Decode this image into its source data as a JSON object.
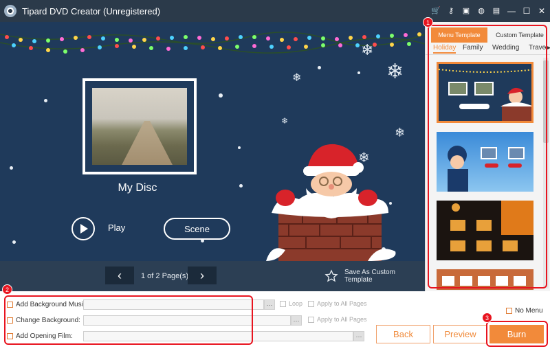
{
  "window": {
    "title": "Tipard DVD Creator (Unregistered)",
    "toolbar_icons": [
      "cart-icon",
      "key-icon",
      "save-icon",
      "help-icon",
      "feedback-icon"
    ],
    "controls": {
      "minimize": "—",
      "maximize": "☐",
      "close": "✕"
    }
  },
  "preview": {
    "disc_title": "My Disc",
    "play_label": "Play",
    "scene_label": "Scene"
  },
  "pagebar": {
    "prev": "‹",
    "next": "›",
    "page_count": "1 of 2 Page(s)",
    "save_template": "Save As Custom Template"
  },
  "right_panel": {
    "tabs": [
      "Menu Template",
      "Custom Template"
    ],
    "active_tab": "Menu Template",
    "categories": [
      "Holiday",
      "Family",
      "Wedding",
      "Trave"
    ],
    "selected_category": "Holiday",
    "templates": [
      "christmas",
      "winter-kid",
      "halloween",
      "travel"
    ]
  },
  "options": {
    "background_music": "Add Background Music:",
    "change_background": "Change Background:",
    "opening_film": "Add Opening Film:",
    "loop": "Loop",
    "apply_all": "Apply to All Pages",
    "no_menu": "No Menu",
    "dots": "···"
  },
  "buttons": {
    "back": "Back",
    "preview": "Preview",
    "burn": "Burn"
  },
  "annotations": {
    "badge1": "1",
    "badge2": "2",
    "badge3": "3"
  },
  "colors": {
    "accent": "#f28a3a",
    "preview_bg": "#1f3a5b",
    "annotation": "#e8141f"
  }
}
